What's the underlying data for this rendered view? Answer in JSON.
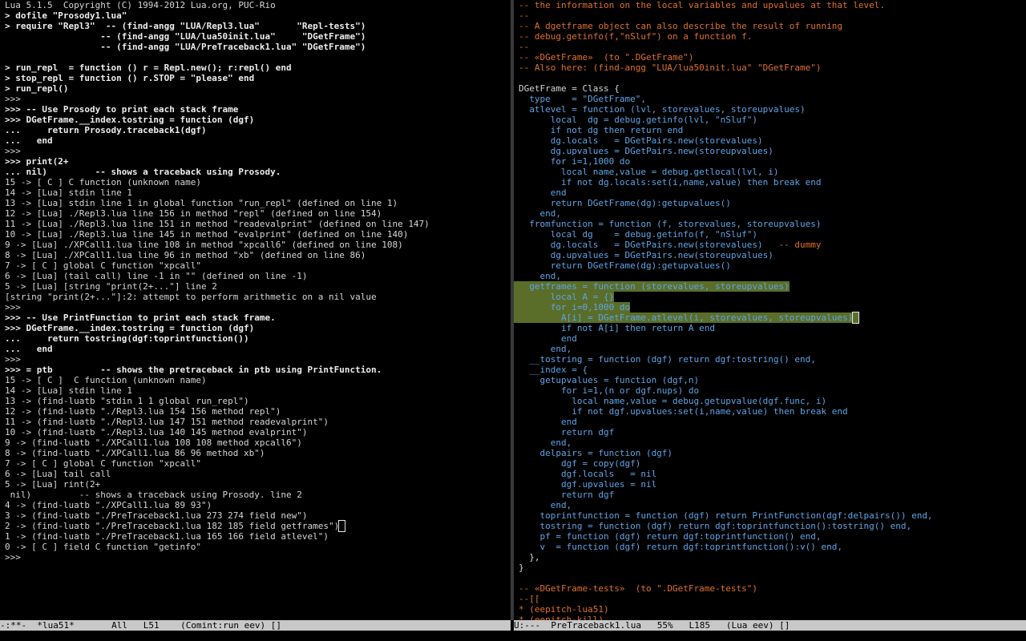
{
  "left_pane": {
    "lines": [
      {
        "text": "Lua 5.1.5  Copyright (C) 1994-2012 Lua.org, PUC-Rio",
        "style": ""
      },
      {
        "text": "> dofile \"Prosody1.lua\"",
        "style": "b"
      },
      {
        "text": "> require \"Repl3\"  -- (find-angg \"LUA/Repl3.lua\"       \"Repl-tests\")",
        "style": "b"
      },
      {
        "text": "                  -- (find-angg \"LUA/lua50init.lua\"     \"DGetFrame\")",
        "style": "b"
      },
      {
        "text": "                  -- (find-angg \"LUA/PreTraceback1.lua\" \"DGetFrame\")",
        "style": "b"
      },
      {
        "text": "",
        "style": ""
      },
      {
        "text": "> run_repl  = function () r = Repl.new(); r:repl() end",
        "style": "b"
      },
      {
        "text": "> stop_repl = function () r.STOP = \"please\" end",
        "style": "b"
      },
      {
        "text": "> run_repl()",
        "style": "b"
      },
      {
        "text": ">>>",
        "style": ""
      },
      {
        "text": ">>> -- Use Prosody to print each stack frame",
        "style": "b"
      },
      {
        "text": ">>> DGetFrame.__index.tostring = function (dgf)",
        "style": "b"
      },
      {
        "text": "...     return Prosody.traceback1(dgf)",
        "style": "b"
      },
      {
        "text": "...   end",
        "style": "b"
      },
      {
        "text": ">>>",
        "style": ""
      },
      {
        "text": ">>> print(2+",
        "style": "b"
      },
      {
        "text": "... nil)         -- shows a traceback using Prosody.",
        "style": "b"
      },
      {
        "text": "15 -> [ C ] C function (unknown name)",
        "style": ""
      },
      {
        "text": "14 -> [Lua] stdin line 1",
        "style": ""
      },
      {
        "text": "13 -> [Lua] stdin line 1 in global function \"run_repl\" (defined on line 1)",
        "style": ""
      },
      {
        "text": "12 -> [Lua] ./Repl3.lua line 156 in method \"repl\" (defined on line 154)",
        "style": ""
      },
      {
        "text": "11 -> [Lua] ./Repl3.lua line 151 in method \"readevalprint\" (defined on line 147)",
        "style": ""
      },
      {
        "text": "10 -> [Lua] ./Repl3.lua line 145 in method \"evalprint\" (defined on line 140)",
        "style": ""
      },
      {
        "text": "9 -> [Lua] ./XPCall1.lua line 108 in method \"xpcall6\" (defined on line 108)",
        "style": ""
      },
      {
        "text": "8 -> [Lua] ./XPCall1.lua line 96 in method \"xb\" (defined on line 86)",
        "style": ""
      },
      {
        "text": "7 -> [ C ] global C function \"xpcall\"",
        "style": ""
      },
      {
        "text": "6 -> [Lua] (tail call) line -1 in \"\" (defined on line -1)",
        "style": ""
      },
      {
        "text": "5 -> [Lua] [string \"print(2+...\"] line 2",
        "style": ""
      },
      {
        "text": "[string \"print(2+...\"]:2: attempt to perform arithmetic on a nil value",
        "style": ""
      },
      {
        "text": ">>>",
        "style": ""
      },
      {
        "text": ">>> -- Use PrintFunction to print each stack frame.",
        "style": "b"
      },
      {
        "text": ">>> DGetFrame.__index.tostring = function (dgf)",
        "style": "b"
      },
      {
        "text": "...     return tostring(dgf:toprintfunction())",
        "style": "b"
      },
      {
        "text": "...   end",
        "style": "b"
      },
      {
        "text": ">>>",
        "style": ""
      },
      {
        "text": ">>> = ptb         -- shows the pretraceback in ptb using PrintFunction.",
        "style": "b"
      },
      {
        "text": "15 -> [ C ]  C function (unknown name)",
        "style": ""
      },
      {
        "text": "14 -> [Lua] stdin line 1",
        "style": ""
      },
      {
        "text": "13 -> (find-luatb \"stdin 1 1 global run_repl\")",
        "style": ""
      },
      {
        "text": "12 -> (find-luatb \"./Repl3.lua 154 156 method repl\")",
        "style": ""
      },
      {
        "text": "11 -> (find-luatb \"./Repl3.lua 147 151 method readevalprint\")",
        "style": ""
      },
      {
        "text": "10 -> (find-luatb \"./Repl3.lua 140 145 method evalprint\")",
        "style": ""
      },
      {
        "text": "9 -> (find-luatb \"./XPCall1.lua 108 108 method xpcall6\")",
        "style": ""
      },
      {
        "text": "8 -> (find-luatb \"./XPCall1.lua 86 96 method xb\")",
        "style": ""
      },
      {
        "text": "7 -> [ C ] global C function \"xpcall\"",
        "style": ""
      },
      {
        "text": "6 -> [Lua] tail call",
        "style": ""
      },
      {
        "text": "5 -> [Lua] rint(2+",
        "style": ""
      },
      {
        "text": " nil)         -- shows a traceback using Prosody. line 2",
        "style": ""
      },
      {
        "text": "4 -> (find-luatb \"./XPCall1.lua 89 93\")",
        "style": ""
      },
      {
        "text": "3 -> (find-luatb \"./PreTraceback1.lua 273 274 field new\")",
        "style": ""
      },
      {
        "text": "2 -> (find-luatb \"./PreTraceback1.lua 182 185 field getframes\")",
        "style": "",
        "cursor": true
      },
      {
        "text": "1 -> (find-luatb \"./PreTraceback1.lua 165 166 field atlevel\")",
        "style": ""
      },
      {
        "text": "0 -> [ C ] field C function \"getinfo\"",
        "style": ""
      },
      {
        "text": ">>>",
        "style": ""
      }
    ]
  },
  "right_pane": {
    "lines": [
      {
        "text": "-- the information on the local variables and upvalues at that level.",
        "style": "c"
      },
      {
        "text": "--",
        "style": "c"
      },
      {
        "text": "-- A dgetframe object can also describe the result of running",
        "style": "c"
      },
      {
        "text": "-- debug.getinfo(f,\"nSluf\") on a function f.",
        "style": "c"
      },
      {
        "text": "--",
        "style": "c"
      },
      {
        "text": "-- «DGetFrame»  (to \".DGetFrame\")",
        "style": "c"
      },
      {
        "text": "-- Also here: (find-angg \"LUA/lua50init.lua\" \"DGetFrame\")",
        "style": "c"
      },
      {
        "text": "",
        "style": ""
      },
      {
        "text": "DGetFrame = Class {",
        "style": ""
      },
      {
        "text": "  type    = \"DGetFrame\",",
        "style": "k"
      },
      {
        "text": "  atlevel = function (lvl, storevalues, storeupvalues)",
        "style": "k"
      },
      {
        "text": "      local  dg = debug.getinfo(lvl, \"nSluf\")",
        "style": "k"
      },
      {
        "text": "      if not dg then return end",
        "style": "k"
      },
      {
        "text": "      dg.locals   = DGetPairs.new(storevalues)",
        "style": "k"
      },
      {
        "text": "      dg.upvalues = DGetPairs.new(storeupvalues)",
        "style": "k"
      },
      {
        "text": "      for i=1,1000 do",
        "style": "k"
      },
      {
        "text": "        local name,value = debug.getlocal(lvl, i)",
        "style": "k"
      },
      {
        "text": "        if not dg.locals:set(i,name,value) then break end",
        "style": "k"
      },
      {
        "text": "      end",
        "style": "k"
      },
      {
        "text": "      return DGetFrame(dg):getupvalues()",
        "style": "k"
      },
      {
        "text": "    end,",
        "style": "k"
      },
      {
        "text": "  fromfunction = function (f, storevalues, storeupvalues)",
        "style": "k"
      },
      {
        "text": "      local dg    = debug.getinfo(f, \"nSluf\")",
        "style": "k"
      },
      {
        "text": "      dg.locals   = DGetPairs.new(storevalues)   -- dummy",
        "style": "k",
        "tail_comment": true
      },
      {
        "text": "      dg.upvalues = DGetPairs.new(storeupvalues)",
        "style": "k"
      },
      {
        "text": "      return DGetFrame(dg):getupvalues()",
        "style": "k"
      },
      {
        "text": "    end,",
        "style": "k"
      },
      {
        "text": "  getframes = function (storevalues, storeupvalues)",
        "style": "k",
        "highlight": true
      },
      {
        "text": "      local A = {}",
        "style": "k",
        "highlight": true
      },
      {
        "text": "      for i=0,1000 do",
        "style": "k",
        "highlight": true
      },
      {
        "text": "        A[i] = DGetFrame.atlevel(i, storevalues, storeupvalues)",
        "style": "k",
        "highlight": true,
        "cursor": true
      },
      {
        "text": "        if not A[i] then return A end",
        "style": "k"
      },
      {
        "text": "        end",
        "style": "k"
      },
      {
        "text": "      end,",
        "style": "k"
      },
      {
        "text": "  __tostring = function (dgf) return dgf:tostring() end,",
        "style": "k"
      },
      {
        "text": "  __index = {",
        "style": "k"
      },
      {
        "text": "    getupvalues = function (dgf,n)",
        "style": "k"
      },
      {
        "text": "        for i=1,(n or dgf.nups) do",
        "style": "k"
      },
      {
        "text": "          local name,value = debug.getupvalue(dgf.func, i)",
        "style": "k"
      },
      {
        "text": "          if not dgf.upvalues:set(i,name,value) then break end",
        "style": "k"
      },
      {
        "text": "        end",
        "style": "k"
      },
      {
        "text": "        return dgf",
        "style": "k"
      },
      {
        "text": "      end,",
        "style": "k"
      },
      {
        "text": "    delpairs = function (dgf)",
        "style": "k"
      },
      {
        "text": "        dgf = copy(dgf)",
        "style": "k"
      },
      {
        "text": "        dgf.locals   = nil",
        "style": "k"
      },
      {
        "text": "        dgf.upvalues = nil",
        "style": "k"
      },
      {
        "text": "        return dgf",
        "style": "k"
      },
      {
        "text": "      end,",
        "style": "k"
      },
      {
        "text": "    toprintfunction = function (dgf) return PrintFunction(dgf:delpairs()) end,",
        "style": "k"
      },
      {
        "text": "    tostring = function (dgf) return dgf:toprintfunction():tostring() end,",
        "style": "k"
      },
      {
        "text": "    pf = function (dgf) return dgf:toprintfunction() end,",
        "style": "k"
      },
      {
        "text": "    v  = function (dgf) return dgf:toprintfunction():v() end,",
        "style": "k"
      },
      {
        "text": "  },",
        "style": ""
      },
      {
        "text": "}",
        "style": ""
      },
      {
        "text": "",
        "style": ""
      },
      {
        "text": "-- «DGetFrame-tests»  (to \".DGetFrame-tests\")",
        "style": "c"
      },
      {
        "text": "--[[",
        "style": "c"
      },
      {
        "text": "* (eepitch-lua51)",
        "style": "c"
      },
      {
        "text": "* (eepitch-kill)",
        "style": "c"
      }
    ]
  },
  "modeline_left": "-:**-  *lua51*       All   L51    (Comint:run eev) []",
  "modeline_right": "U:---  PreTraceback1.lua   55%   L185   (Lua eev) []",
  "colors": {
    "background": "#000000",
    "comment": "#e0702c",
    "keyword": "#5fa4e6",
    "region_highlight": "#5a6e2a",
    "modeline_bg": "#c8c8c8"
  }
}
